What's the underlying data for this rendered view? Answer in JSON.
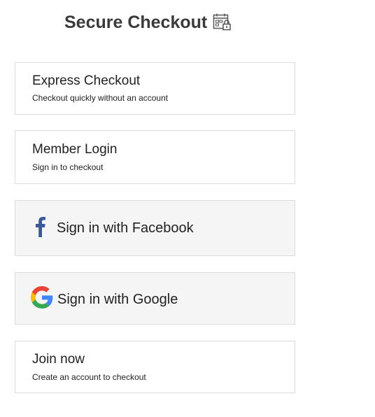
{
  "header": {
    "title": "Secure Checkout",
    "icon": "calendar-lock-icon"
  },
  "options": {
    "express": {
      "title": "Express Checkout",
      "subtitle": "Checkout quickly without an account"
    },
    "member": {
      "title": "Member Login",
      "subtitle": "Sign in to checkout"
    },
    "facebook": {
      "label": "Sign in with Facebook",
      "icon": "facebook-icon",
      "icon_color": "#3b5998"
    },
    "google": {
      "label": "Sign in with Google",
      "icon": "google-icon",
      "icon_colors": [
        "#4285F4",
        "#EA4335",
        "#FBBC05",
        "#34A853"
      ]
    },
    "join": {
      "title": "Join now",
      "subtitle": "Create an account to checkout"
    }
  }
}
